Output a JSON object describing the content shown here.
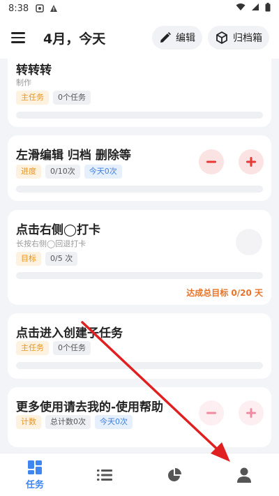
{
  "status_bar": {
    "time": "8:38"
  },
  "header": {
    "title": "4月，今天",
    "edit_label": "编辑",
    "archive_label": "归档箱"
  },
  "tasks": [
    {
      "name": "转转转",
      "subtitle": "制作",
      "tags": [
        "主任务",
        "0个任务"
      ]
    },
    {
      "name": "左滑编辑 归档 删除等",
      "tags": [
        "进度",
        "0/10次",
        "今天0次"
      ]
    },
    {
      "name": "点击右侧◯打卡",
      "subtitle": "长按右侧◯回退打卡",
      "tags": [
        "目标",
        "0/5 次"
      ],
      "goal_text": "达成总目标 0/20 天"
    },
    {
      "name": "点击进入创建子任务",
      "tags": [
        "主任务",
        "0个任务"
      ]
    },
    {
      "name": "更多使用请去我的-使用帮助",
      "tags": [
        "计数",
        "总计数0次",
        "今天0次"
      ]
    }
  ],
  "bottom_nav": {
    "tasks_label": "任务",
    "active": "tasks"
  },
  "icons": [
    "menu-icon",
    "pencil-icon",
    "cube-icon",
    "minus-icon",
    "plus-icon",
    "grid-icon",
    "list-icon",
    "pie-chart-icon",
    "person-icon"
  ],
  "colors": {
    "accent": "#3f86f0",
    "minus_red": "#e53935",
    "goal_orange": "#e8742a"
  }
}
